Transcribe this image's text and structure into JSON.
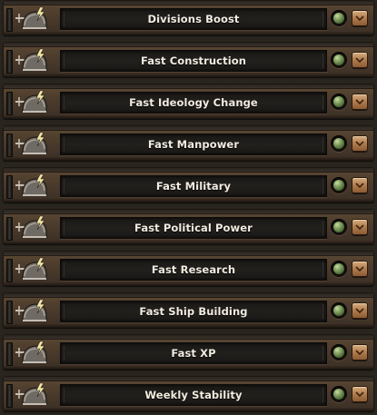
{
  "mods": [
    {
      "label": "Divisions Boost",
      "enabled": true
    },
    {
      "label": "Fast Construction",
      "enabled": true
    },
    {
      "label": "Fast Ideology Change",
      "enabled": true
    },
    {
      "label": "Fast Manpower",
      "enabled": true
    },
    {
      "label": "Fast Military",
      "enabled": true
    },
    {
      "label": "Fast Political Power",
      "enabled": true
    },
    {
      "label": "Fast Research",
      "enabled": true
    },
    {
      "label": "Fast Ship Building",
      "enabled": true
    },
    {
      "label": "Fast XP",
      "enabled": true
    },
    {
      "label": "Weekly Stability",
      "enabled": true
    }
  ],
  "icons": {
    "row_icon": "helmet-lightning-icon",
    "status": "green-led-icon",
    "expand": "chevron-down-icon"
  },
  "colors": {
    "row_wood": "#4f3e2d",
    "label_plate": "#1f1d1a",
    "label_text": "#f2ece1",
    "led_green": "#7e9c5e",
    "expand_button": "#b3804f"
  }
}
